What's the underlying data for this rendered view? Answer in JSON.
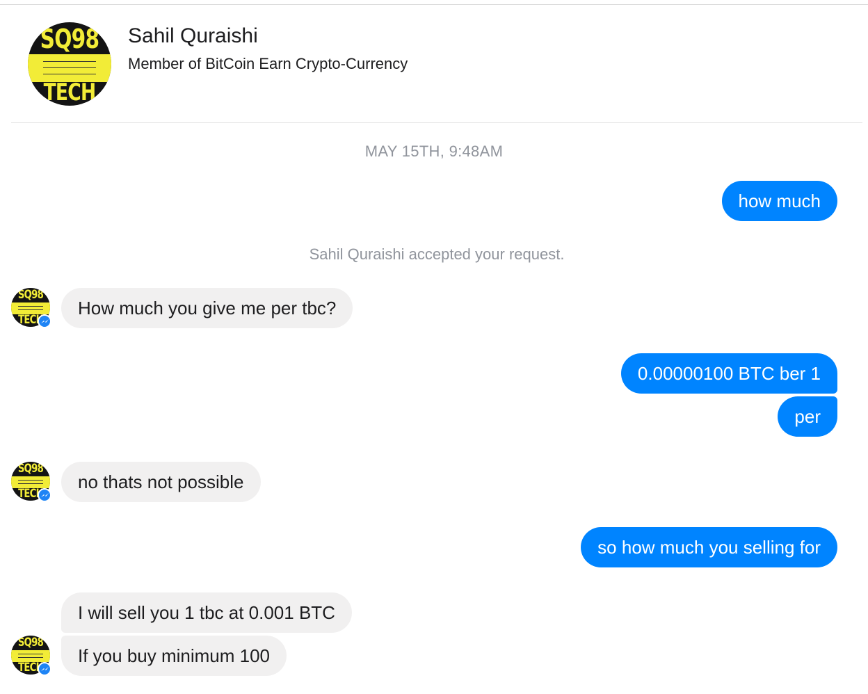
{
  "header": {
    "name": "Sahil Quraishi",
    "subtitle": "Member of BitCoin Earn Crypto-Currency",
    "avatar": {
      "logo_top": "SQ98",
      "logo_bottom": "TECH"
    }
  },
  "conversation": {
    "timestamp": "MAY 15TH, 9:48AM",
    "system_message": "Sahil Quraishi accepted your request.",
    "messages": [
      {
        "sender": "me",
        "text": "how much"
      },
      {
        "sender": "contact",
        "text": "How much you give me per tbc?"
      },
      {
        "sender": "me",
        "text": "0.00000100 BTC ber 1"
      },
      {
        "sender": "me",
        "text": "per"
      },
      {
        "sender": "contact",
        "text": "no thats not possible"
      },
      {
        "sender": "me",
        "text": "so how much you selling for"
      },
      {
        "sender": "contact",
        "text": "I will sell you 1 tbc at 0.001 BTC"
      },
      {
        "sender": "contact",
        "text": "If you buy minimum 100"
      }
    ]
  },
  "icons": {
    "badge": "messenger-icon"
  },
  "colors": {
    "outgoing_bubble": "#0084ff",
    "incoming_bubble": "#f1f0f0",
    "meta_text": "#90949c",
    "logo_yellow": "#f2ec37",
    "badge_blue": "#1e84f5"
  }
}
